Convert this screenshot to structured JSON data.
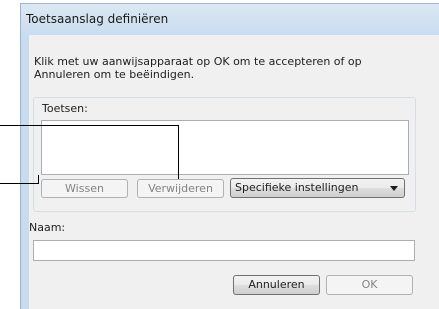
{
  "window": {
    "title": "Toetsaanslag definiëren"
  },
  "dialog": {
    "instruction": "Klik met uw aanwijsapparaat op OK om te accepteren of op Annuleren om te beëindigen.",
    "keys_group_label": "Toetsen:",
    "keys_value": "",
    "buttons": {
      "clear": "Wissen",
      "remove": "Verwijderen",
      "cancel": "Annuleren",
      "ok": "OK"
    },
    "special_settings": {
      "selected": "Specifieke instellingen"
    },
    "name_label": "Naam:",
    "name_value": ""
  },
  "colors": {
    "titlebar": "#c9dcef",
    "dialog_bg": "#f0f0f0",
    "callout_lines": "#000000"
  }
}
